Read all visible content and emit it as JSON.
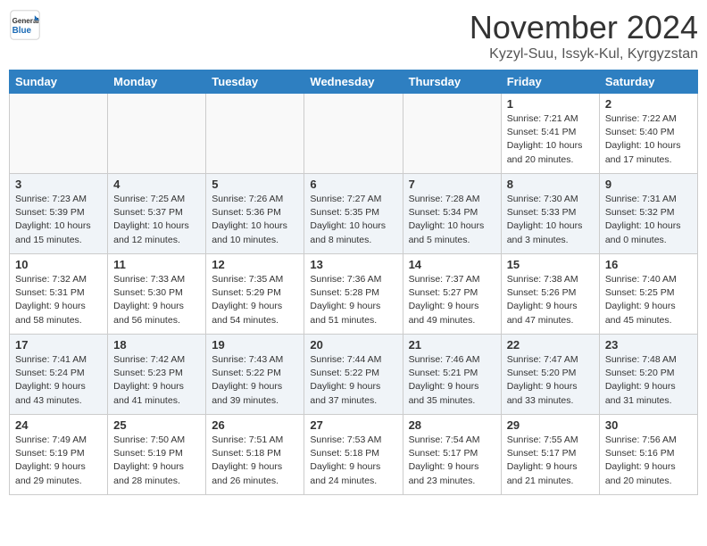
{
  "header": {
    "logo_line1": "General",
    "logo_line2": "Blue",
    "month_title": "November 2024",
    "location": "Kyzyl-Suu, Issyk-Kul, Kyrgyzstan"
  },
  "days_of_week": [
    "Sunday",
    "Monday",
    "Tuesday",
    "Wednesday",
    "Thursday",
    "Friday",
    "Saturday"
  ],
  "weeks": [
    [
      {
        "day": "",
        "info": ""
      },
      {
        "day": "",
        "info": ""
      },
      {
        "day": "",
        "info": ""
      },
      {
        "day": "",
        "info": ""
      },
      {
        "day": "",
        "info": ""
      },
      {
        "day": "1",
        "info": "Sunrise: 7:21 AM\nSunset: 5:41 PM\nDaylight: 10 hours\nand 20 minutes."
      },
      {
        "day": "2",
        "info": "Sunrise: 7:22 AM\nSunset: 5:40 PM\nDaylight: 10 hours\nand 17 minutes."
      }
    ],
    [
      {
        "day": "3",
        "info": "Sunrise: 7:23 AM\nSunset: 5:39 PM\nDaylight: 10 hours\nand 15 minutes."
      },
      {
        "day": "4",
        "info": "Sunrise: 7:25 AM\nSunset: 5:37 PM\nDaylight: 10 hours\nand 12 minutes."
      },
      {
        "day": "5",
        "info": "Sunrise: 7:26 AM\nSunset: 5:36 PM\nDaylight: 10 hours\nand 10 minutes."
      },
      {
        "day": "6",
        "info": "Sunrise: 7:27 AM\nSunset: 5:35 PM\nDaylight: 10 hours\nand 8 minutes."
      },
      {
        "day": "7",
        "info": "Sunrise: 7:28 AM\nSunset: 5:34 PM\nDaylight: 10 hours\nand 5 minutes."
      },
      {
        "day": "8",
        "info": "Sunrise: 7:30 AM\nSunset: 5:33 PM\nDaylight: 10 hours\nand 3 minutes."
      },
      {
        "day": "9",
        "info": "Sunrise: 7:31 AM\nSunset: 5:32 PM\nDaylight: 10 hours\nand 0 minutes."
      }
    ],
    [
      {
        "day": "10",
        "info": "Sunrise: 7:32 AM\nSunset: 5:31 PM\nDaylight: 9 hours\nand 58 minutes."
      },
      {
        "day": "11",
        "info": "Sunrise: 7:33 AM\nSunset: 5:30 PM\nDaylight: 9 hours\nand 56 minutes."
      },
      {
        "day": "12",
        "info": "Sunrise: 7:35 AM\nSunset: 5:29 PM\nDaylight: 9 hours\nand 54 minutes."
      },
      {
        "day": "13",
        "info": "Sunrise: 7:36 AM\nSunset: 5:28 PM\nDaylight: 9 hours\nand 51 minutes."
      },
      {
        "day": "14",
        "info": "Sunrise: 7:37 AM\nSunset: 5:27 PM\nDaylight: 9 hours\nand 49 minutes."
      },
      {
        "day": "15",
        "info": "Sunrise: 7:38 AM\nSunset: 5:26 PM\nDaylight: 9 hours\nand 47 minutes."
      },
      {
        "day": "16",
        "info": "Sunrise: 7:40 AM\nSunset: 5:25 PM\nDaylight: 9 hours\nand 45 minutes."
      }
    ],
    [
      {
        "day": "17",
        "info": "Sunrise: 7:41 AM\nSunset: 5:24 PM\nDaylight: 9 hours\nand 43 minutes."
      },
      {
        "day": "18",
        "info": "Sunrise: 7:42 AM\nSunset: 5:23 PM\nDaylight: 9 hours\nand 41 minutes."
      },
      {
        "day": "19",
        "info": "Sunrise: 7:43 AM\nSunset: 5:22 PM\nDaylight: 9 hours\nand 39 minutes."
      },
      {
        "day": "20",
        "info": "Sunrise: 7:44 AM\nSunset: 5:22 PM\nDaylight: 9 hours\nand 37 minutes."
      },
      {
        "day": "21",
        "info": "Sunrise: 7:46 AM\nSunset: 5:21 PM\nDaylight: 9 hours\nand 35 minutes."
      },
      {
        "day": "22",
        "info": "Sunrise: 7:47 AM\nSunset: 5:20 PM\nDaylight: 9 hours\nand 33 minutes."
      },
      {
        "day": "23",
        "info": "Sunrise: 7:48 AM\nSunset: 5:20 PM\nDaylight: 9 hours\nand 31 minutes."
      }
    ],
    [
      {
        "day": "24",
        "info": "Sunrise: 7:49 AM\nSunset: 5:19 PM\nDaylight: 9 hours\nand 29 minutes."
      },
      {
        "day": "25",
        "info": "Sunrise: 7:50 AM\nSunset: 5:19 PM\nDaylight: 9 hours\nand 28 minutes."
      },
      {
        "day": "26",
        "info": "Sunrise: 7:51 AM\nSunset: 5:18 PM\nDaylight: 9 hours\nand 26 minutes."
      },
      {
        "day": "27",
        "info": "Sunrise: 7:53 AM\nSunset: 5:18 PM\nDaylight: 9 hours\nand 24 minutes."
      },
      {
        "day": "28",
        "info": "Sunrise: 7:54 AM\nSunset: 5:17 PM\nDaylight: 9 hours\nand 23 minutes."
      },
      {
        "day": "29",
        "info": "Sunrise: 7:55 AM\nSunset: 5:17 PM\nDaylight: 9 hours\nand 21 minutes."
      },
      {
        "day": "30",
        "info": "Sunrise: 7:56 AM\nSunset: 5:16 PM\nDaylight: 9 hours\nand 20 minutes."
      }
    ]
  ]
}
